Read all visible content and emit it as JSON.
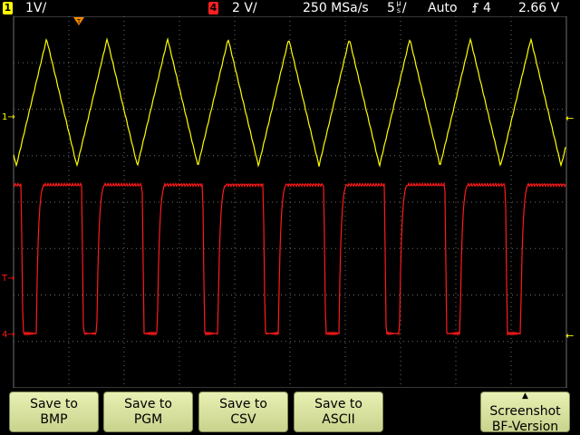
{
  "status_bar": {
    "ch1": {
      "number": "1",
      "scale": "1V/",
      "color": "#ffff00"
    },
    "ch4": {
      "number": "4",
      "scale": "2 V/",
      "color": "#ff2020"
    },
    "sample_rate": "250 MSa/s",
    "timebase": "5",
    "timebase_unit_top": "µ",
    "timebase_unit_bottom": "s",
    "timebase_slash": "/",
    "trigger_mode": "Auto",
    "trigger_source": "4",
    "trigger_level": "2.66 V"
  },
  "markers": {
    "ch1_ground": "1",
    "ch4_ground": "4",
    "trigger_level": "T"
  },
  "softkeys": {
    "save_bmp": {
      "line1": "Save to",
      "line2": "BMP"
    },
    "save_pgm": {
      "line1": "Save to",
      "line2": "PGM"
    },
    "save_csv": {
      "line1": "Save to",
      "line2": "CSV"
    },
    "save_ascii": {
      "line1": "Save to",
      "line2": "ASCII"
    },
    "screenshot": {
      "line1": "Screenshot",
      "line2": "BF-Version"
    }
  },
  "colors": {
    "ch1": "#ffff00",
    "ch4": "#ff1a1a",
    "grid": "#6e6e6e",
    "trigger_marker": "#ff8c00"
  }
}
